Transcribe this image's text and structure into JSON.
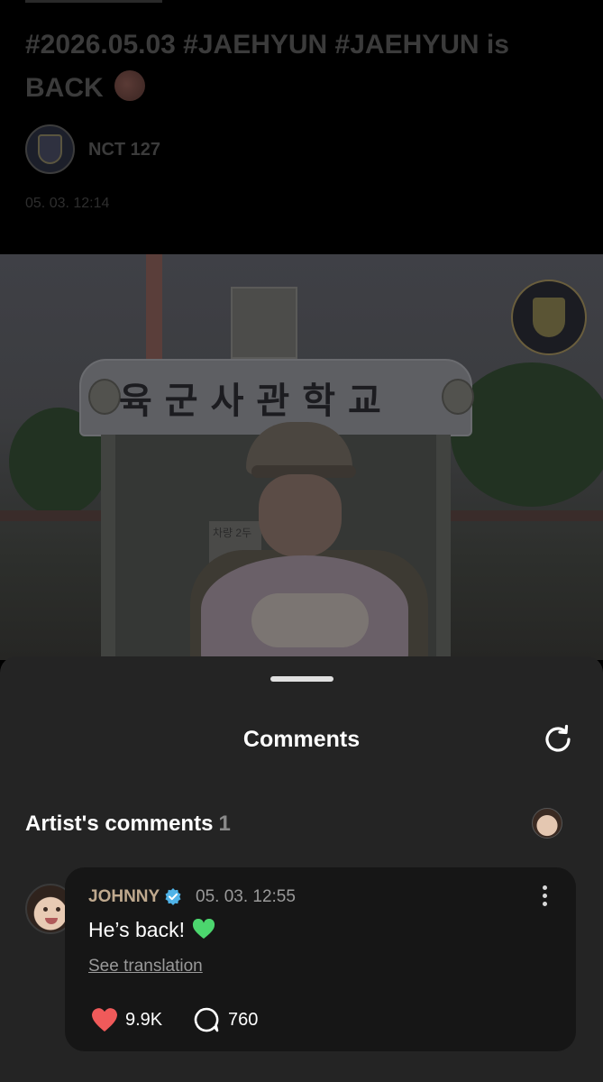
{
  "post": {
    "title_text": "#2026.05.03 #JAEHYUN #JAEHYUN is BACK",
    "title_emoji": "peach",
    "author": "NCT 127",
    "timestamp": "05. 03. 12:14"
  },
  "photo": {
    "sign_text": "육군사관학교",
    "booth_notice_text": "차량 2두"
  },
  "comments_sheet": {
    "title": "Comments",
    "refresh_icon": "refresh-icon",
    "artist_section": {
      "label": "Artist's comments",
      "count": "1"
    },
    "comment": {
      "author": "JOHNNY",
      "verified": true,
      "time": "05. 03. 12:55",
      "text": "He’s back!",
      "text_emoji": "green-heart",
      "see_translation": "See translation",
      "likes": "9.9K",
      "replies": "760"
    }
  },
  "colors": {
    "accent_like": "#f05a5a",
    "verified": "#4fb3e8",
    "author_name": "#bfa98e"
  }
}
